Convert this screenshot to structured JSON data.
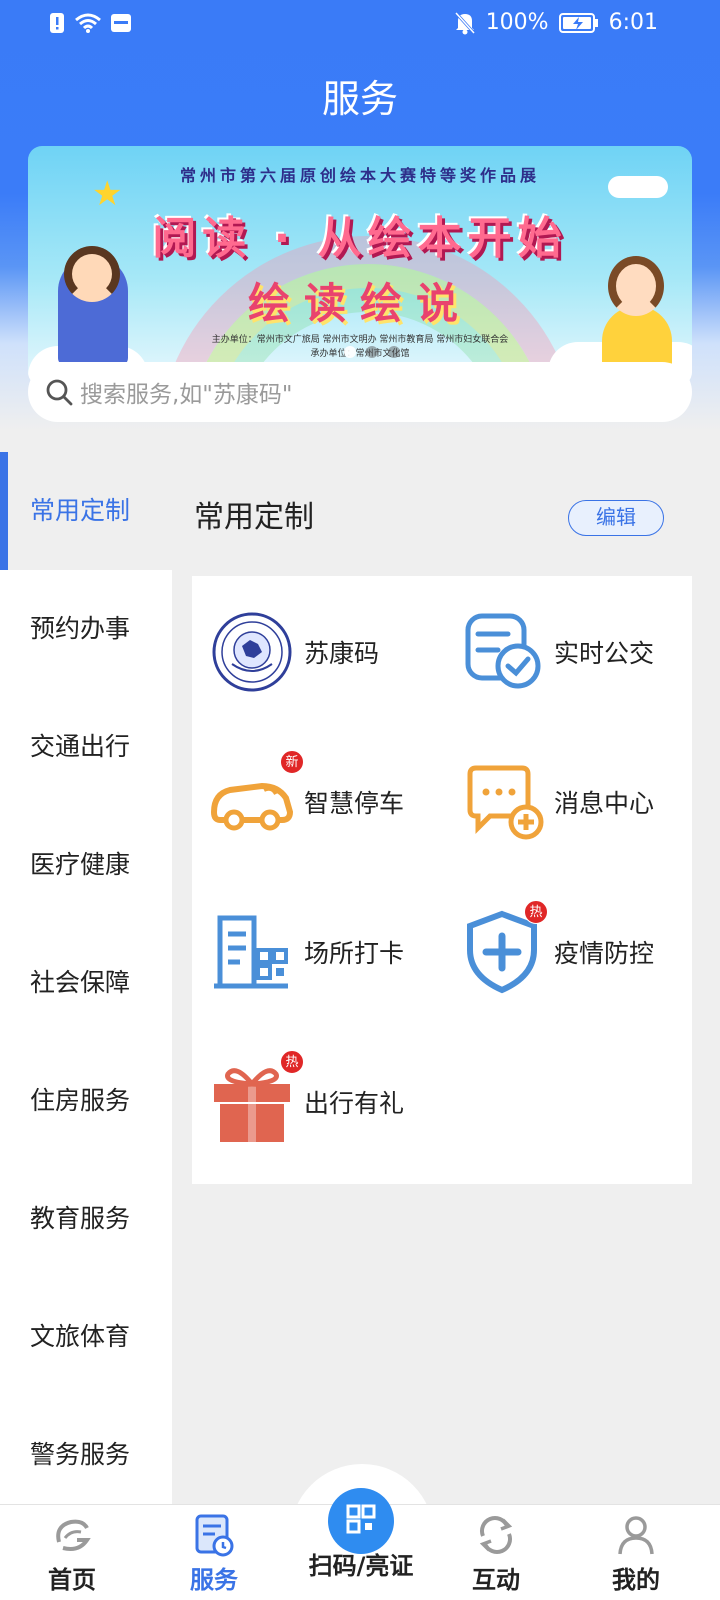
{
  "status_bar": {
    "battery": "100%",
    "time": "6:01"
  },
  "page": {
    "title": "服务"
  },
  "banner": {
    "top_text": "常州市第六届原创绘本大赛特等奖作品展",
    "main_text": "阅读 · 从绘本开始",
    "sub_text": "绘读绘说",
    "org_text": "主办单位：常州市文广旅局  常州市文明办  常州市教育局  常州市妇女联合会",
    "host_text": "承办单位：常州市文化馆"
  },
  "search": {
    "placeholder": "搜索服务,如\"苏康码\""
  },
  "sidebar": {
    "items": [
      {
        "label": "常用定制",
        "active": true
      },
      {
        "label": "预约办事"
      },
      {
        "label": "交通出行"
      },
      {
        "label": "医疗健康"
      },
      {
        "label": "社会保障"
      },
      {
        "label": "住房服务"
      },
      {
        "label": "教育服务"
      },
      {
        "label": "文旅体育"
      },
      {
        "label": "警务服务"
      }
    ]
  },
  "section": {
    "title": "常用定制",
    "edit_label": "编辑"
  },
  "services": [
    {
      "label": "苏康码",
      "icon": "sukang-emblem-icon"
    },
    {
      "label": "实时公交",
      "icon": "bus-check-icon"
    },
    {
      "label": "智慧停车",
      "icon": "parking-car-icon",
      "badge": "新"
    },
    {
      "label": "消息中心",
      "icon": "message-plus-icon"
    },
    {
      "label": "场所打卡",
      "icon": "building-qr-icon"
    },
    {
      "label": "疫情防控",
      "icon": "shield-plus-icon",
      "badge": "热"
    },
    {
      "label": "出行有礼",
      "icon": "gift-icon",
      "badge": "热"
    }
  ],
  "tabbar": {
    "items": [
      {
        "label": "首页",
        "icon": "home-logo-icon"
      },
      {
        "label": "服务",
        "icon": "service-doc-icon",
        "active": true
      },
      {
        "label": "扫码/亮证",
        "icon": "qr-scan-icon"
      },
      {
        "label": "互动",
        "icon": "refresh-icon"
      },
      {
        "label": "我的",
        "icon": "user-icon"
      }
    ]
  },
  "colors": {
    "primary": "#3a7bf7",
    "accent_blue": "#3a73e6",
    "badge_red": "#e02727",
    "orange": "#f0a33a",
    "gift_red": "#e06550"
  }
}
